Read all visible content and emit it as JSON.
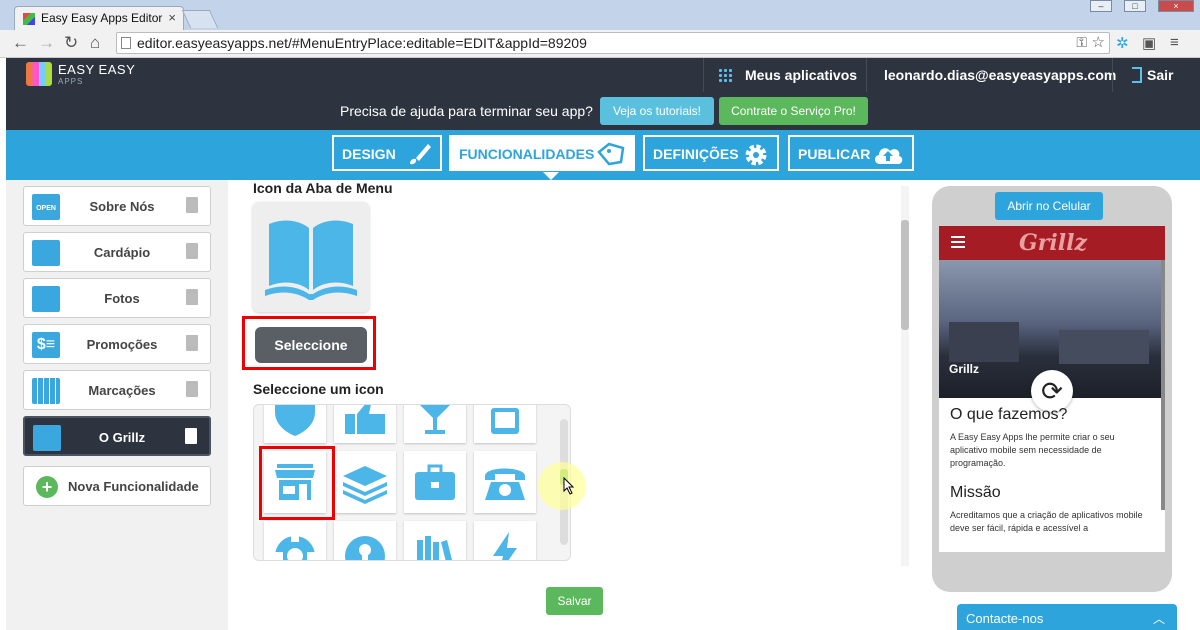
{
  "browser": {
    "tab_title": "Easy Easy Apps Editor",
    "url": "editor.easyeasyapps.net/#MenuEntryPlace:editable=EDIT&appId=89209"
  },
  "header": {
    "logo_line1": "EASY EASY",
    "logo_line2": "APPS",
    "my_apps": "Meus aplicativos",
    "user_email": "leonardo.dias@easyeasyapps.com",
    "logout": "Sair"
  },
  "helpbar": {
    "text": "Precisa de ajuda para terminar seu app?",
    "tutorials_button": "Veja os tutoriais!",
    "pro_button": "Contrate o Serviço Pro!"
  },
  "menu": {
    "tabs": [
      {
        "label": "DESIGN",
        "icon": "brush-icon"
      },
      {
        "label": "FUNCIONALIDADES",
        "icon": "tag-icon"
      },
      {
        "label": "DEFINIÇÕES",
        "icon": "gear-icon"
      },
      {
        "label": "PUBLICAR",
        "icon": "cloud-upload-icon"
      }
    ],
    "active": "FUNCIONALIDADES"
  },
  "sidebar": {
    "items": [
      {
        "label": "Sobre Nós",
        "icon": "open-sign-icon"
      },
      {
        "label": "Cardápio",
        "icon": "book-icon"
      },
      {
        "label": "Fotos",
        "icon": "photos-icon"
      },
      {
        "label": "Promoções",
        "icon": "price-list-icon"
      },
      {
        "label": "Marcações",
        "icon": "calendar-icon"
      },
      {
        "label": "O Grillz",
        "icon": "book-icon"
      }
    ],
    "active": "O Grillz",
    "add_label": "Nova Funcionalidade"
  },
  "main": {
    "tab_icon_heading": "Icon da Aba de Menu",
    "select_button": "Seleccione",
    "select_icon_heading": "Seleccione um icon",
    "save_button": "Salvar"
  },
  "preview": {
    "open_phone_button": "Abrir no Celular",
    "brand": "Grillz",
    "photo_caption": "Grillz",
    "section1_title": "O que fazemos?",
    "section1_text": "A Easy Easy Apps lhe permite criar o seu aplicativo mobile sem necessidade de programação.",
    "section2_title": "Missão",
    "section2_text": "Acreditamos que a criação de aplicativos mobile deve ser fácil, rápida e acessível a"
  },
  "contact": {
    "label": "Contacte-nos"
  },
  "colors": {
    "primary": "#2ea4dd",
    "dark": "#2d3440",
    "green": "#5cb85c",
    "highlight_red": "#e00000",
    "icon_blue": "#4cb6e8"
  }
}
